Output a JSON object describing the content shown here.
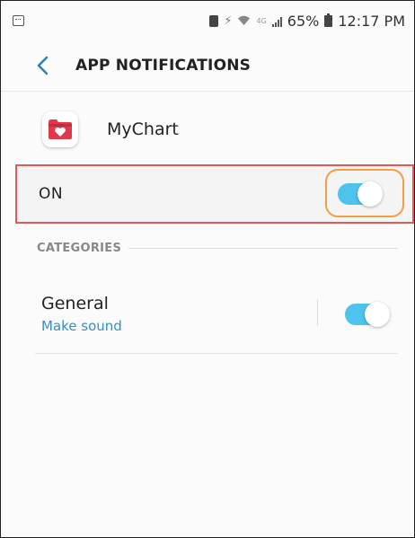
{
  "status_bar": {
    "battery_percent": "65%",
    "time": "12:17 PM",
    "network_label": "4G"
  },
  "header": {
    "title": "APP NOTIFICATIONS"
  },
  "app": {
    "name": "MyChart",
    "icon_color": "#e0394c"
  },
  "master_toggle": {
    "label": "ON",
    "state": "on"
  },
  "categories": {
    "heading": "CATEGORIES",
    "items": [
      {
        "title": "General",
        "subtitle": "Make sound",
        "state": "on"
      }
    ]
  },
  "colors": {
    "accent": "#4ec3ee",
    "highlight_row_border": "#e05a5a",
    "highlight_toggle_border": "#f0a040",
    "subtitle": "#3a8dc0"
  }
}
